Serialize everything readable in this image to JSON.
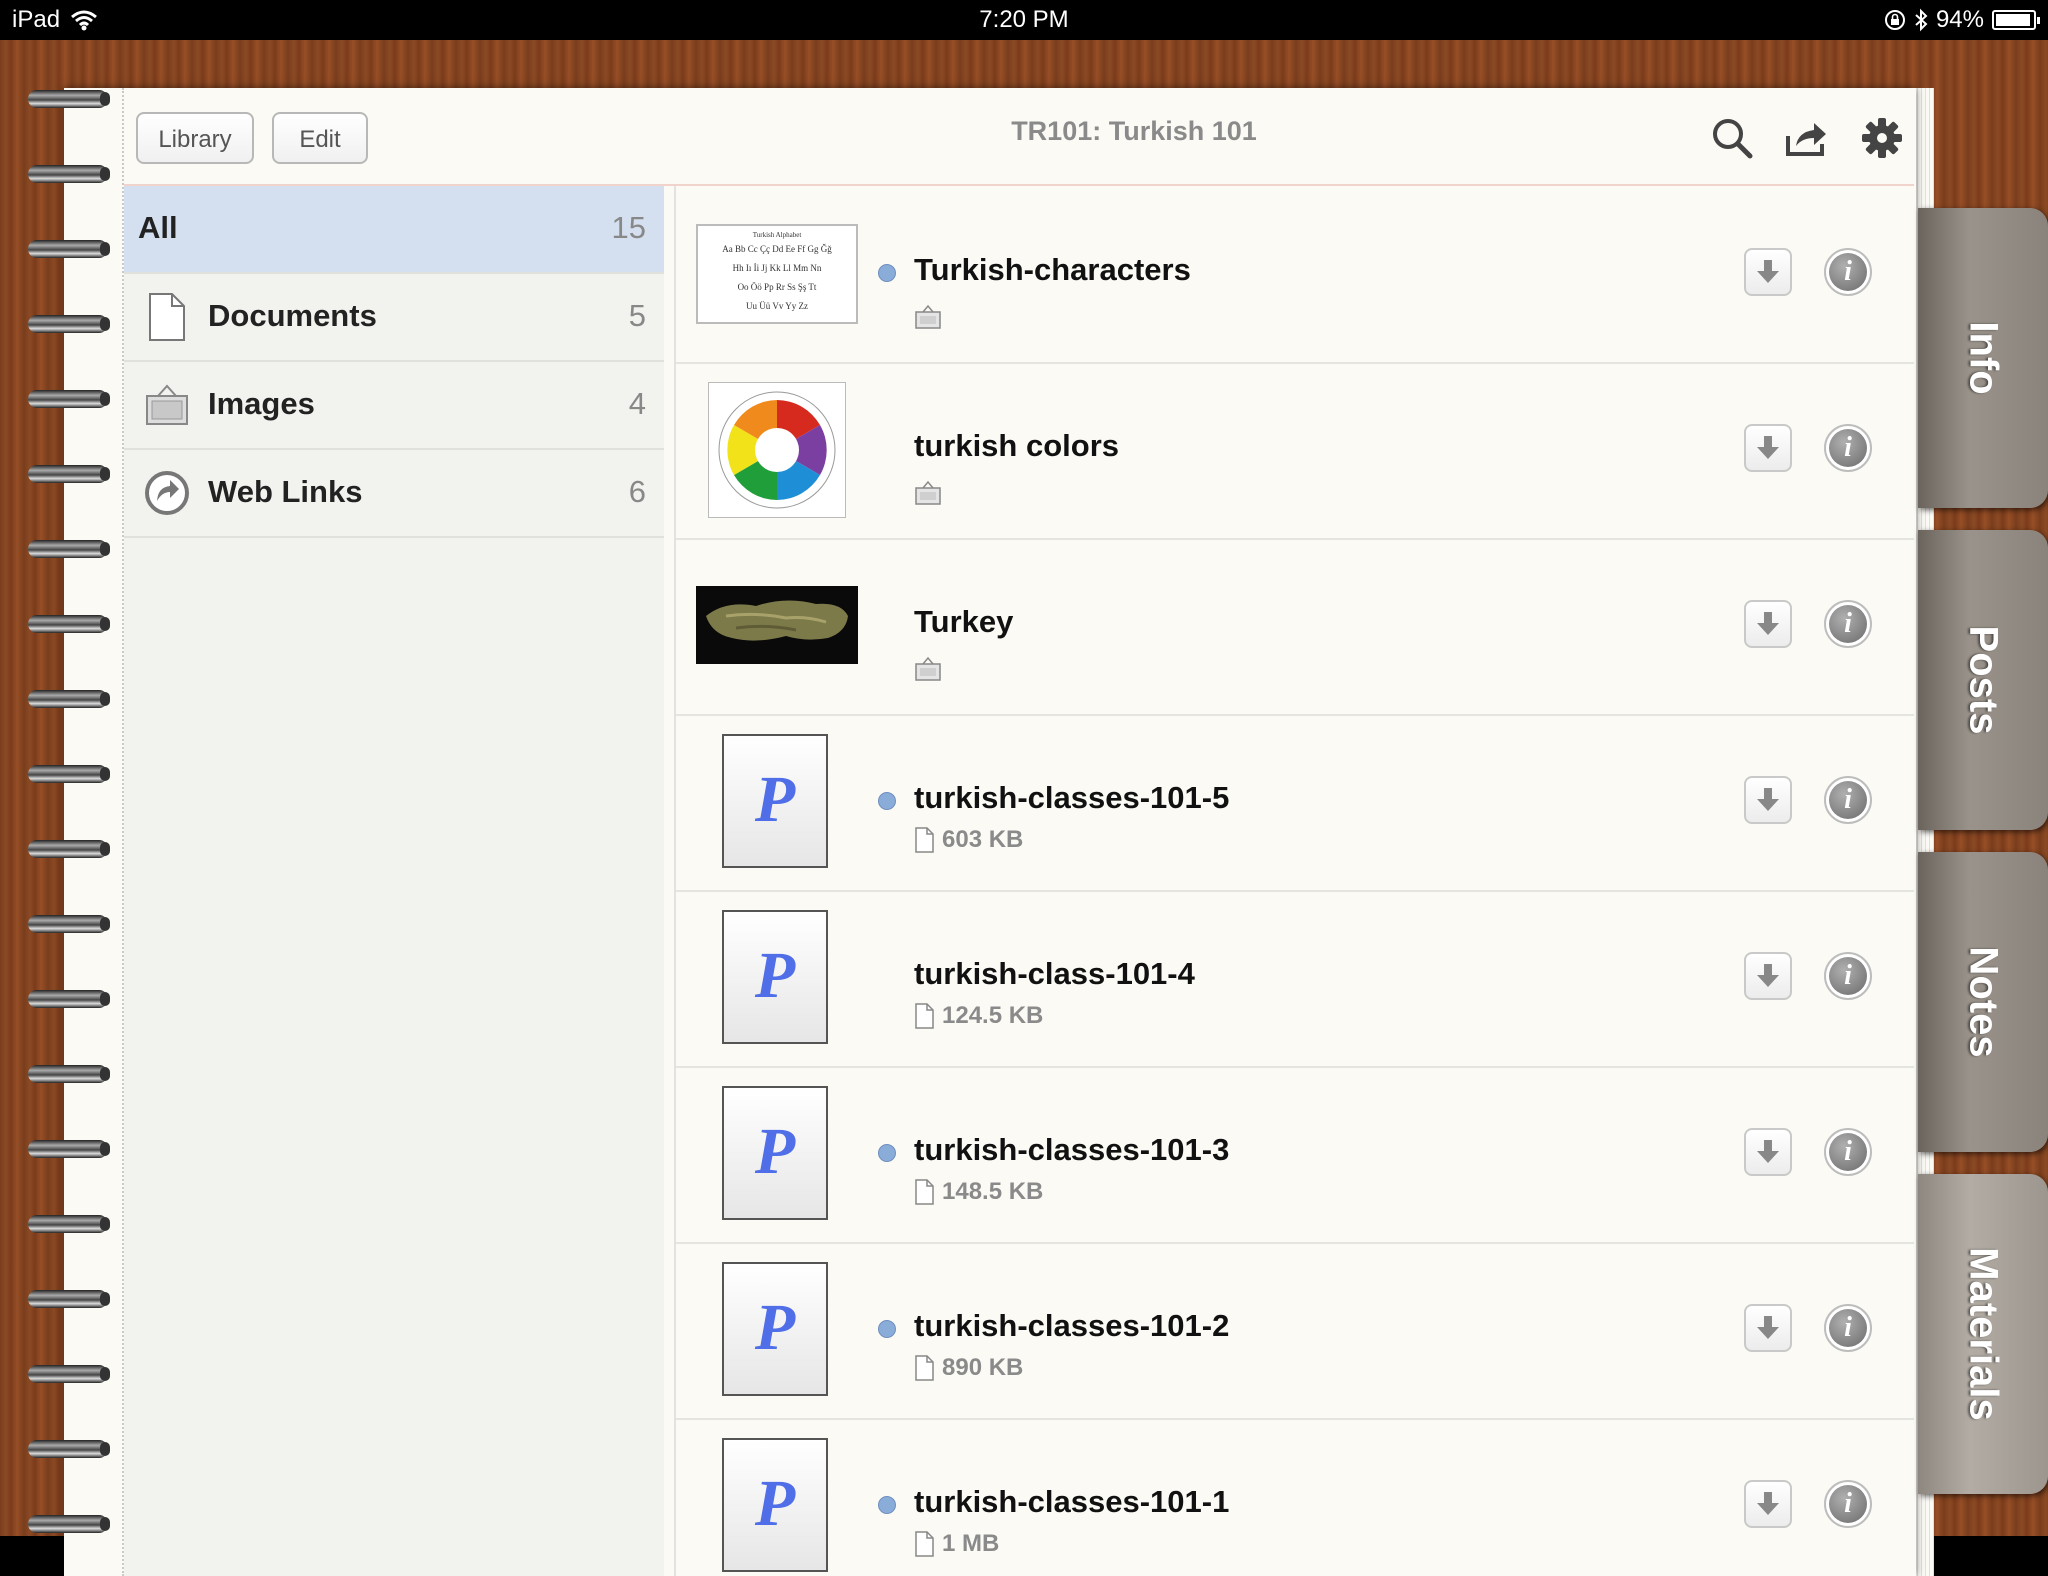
{
  "status_bar": {
    "device": "iPad",
    "time": "7:20 PM",
    "battery_text": "94%",
    "battery_level": 0.94
  },
  "header": {
    "library_label": "Library",
    "edit_label": "Edit",
    "title": "TR101: Turkish 101"
  },
  "sidebar": {
    "items": [
      {
        "label": "All",
        "count": "15",
        "selected": true
      },
      {
        "label": "Documents",
        "count": "5",
        "icon": "document-icon"
      },
      {
        "label": "Images",
        "count": "4",
        "icon": "image-icon"
      },
      {
        "label": "Web Links",
        "count": "6",
        "icon": "web-link-icon"
      }
    ]
  },
  "materials": [
    {
      "title": "Turkish-characters",
      "unread": true,
      "type": "image",
      "thumb": "alphabet-chart",
      "thumb_text": [
        "Turkish Alphabet",
        "Aa Bb Cc Çç Dd Ee Ff Gg Ğğ",
        "Hh Iı İi Jj Kk Ll Mm Nn",
        "Oo Öö Pp Rr Ss Şş Tt",
        "Uu Üü Vv Yy Zz"
      ]
    },
    {
      "title": "turkish colors",
      "unread": false,
      "type": "image",
      "thumb": "color-wheel"
    },
    {
      "title": "Turkey",
      "unread": false,
      "type": "image",
      "thumb": "map"
    },
    {
      "title": "turkish-classes-101-5",
      "unread": true,
      "type": "document",
      "size": "603 KB"
    },
    {
      "title": "turkish-class-101-4",
      "unread": false,
      "type": "document",
      "size": "124.5 KB"
    },
    {
      "title": "turkish-classes-101-3",
      "unread": true,
      "type": "document",
      "size": "148.5 KB"
    },
    {
      "title": "turkish-classes-101-2",
      "unread": true,
      "type": "document",
      "size": "890 KB"
    },
    {
      "title": "turkish-classes-101-1",
      "unread": true,
      "type": "document",
      "size": "1 MB"
    }
  ],
  "doc_thumb_letter": "P",
  "info_glyph": "i",
  "tabs": [
    {
      "label": "Info"
    },
    {
      "label": "Posts"
    },
    {
      "label": "Notes"
    },
    {
      "label": "Materials",
      "active": true
    }
  ],
  "colors": {
    "selected_row": "#d4dff0",
    "unread_dot": "#8aacd8",
    "doc_letter": "#4f6ee8"
  }
}
